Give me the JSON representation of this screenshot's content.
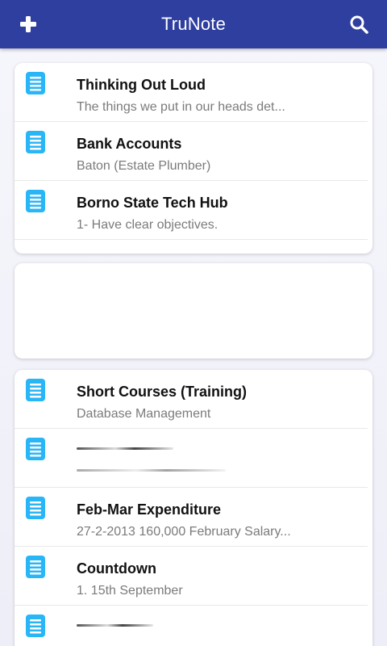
{
  "appbar": {
    "title": "TruNote",
    "background": "#2f3f9f",
    "add_icon": "plus-icon",
    "search_icon": "search-icon"
  },
  "accent": "#29b6f6",
  "groups": [
    {
      "notes": [
        {
          "title": "Thinking Out Loud",
          "preview": "The things we put in our heads det..."
        },
        {
          "title": "Bank Accounts",
          "preview": "Baton (Estate Plumber)"
        },
        {
          "title": "Borno State Tech Hub",
          "preview": "1- Have clear objectives."
        }
      ]
    },
    {
      "notes": []
    },
    {
      "notes": [
        {
          "title": "Short Courses (Training)",
          "preview": "Database Management"
        },
        {
          "title": "",
          "preview": ""
        },
        {
          "title": "Feb-Mar Expenditure",
          "preview": "27-2-2013 160,000 February Salary..."
        },
        {
          "title": "Countdown",
          "preview": "1. 15th September"
        },
        {
          "title": "",
          "preview": ""
        }
      ]
    }
  ]
}
